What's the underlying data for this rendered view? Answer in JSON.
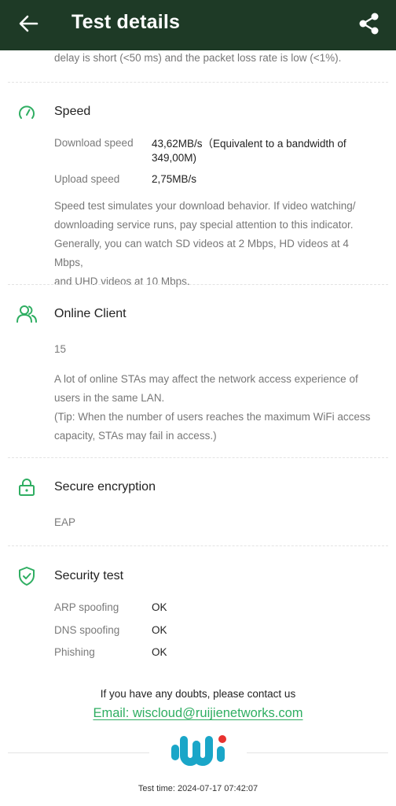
{
  "header": {
    "title": "Test details",
    "back_icon": "arrow-left-icon",
    "share_icon": "share-icon",
    "background": "#1e3a26"
  },
  "top_clip_text": "delay is short (<50 ms) and the packet loss rate is low (<1%).",
  "speed": {
    "title": "Speed",
    "icon": "speedometer-icon",
    "rows": [
      {
        "label": "Download speed",
        "value": "43,62MB/s（Equivalent to a bandwidth of",
        "value2": "349,00M)"
      },
      {
        "label": "Upload speed",
        "value": "2,75MB/s"
      }
    ],
    "description": [
      "Speed test simulates your download behavior. If video watching/",
      "downloading service runs, pay special attention to this indicator.",
      "Generally, you can watch SD videos at 2 Mbps, HD videos at 4 Mbps,",
      "and UHD videos at 10 Mbps."
    ]
  },
  "online_client": {
    "title": "Online Client",
    "icon": "users-icon",
    "count": "15",
    "description": [
      "A lot of online STAs may affect the network access experience of",
      "users in the same LAN.",
      "(Tip: When the number of users reaches the maximum WiFi access",
      "capacity, STAs may fail in access.)"
    ]
  },
  "secure_encryption": {
    "title": "Secure encryption",
    "icon": "lock-icon",
    "value": "EAP"
  },
  "security_test": {
    "title": "Security test",
    "icon": "shield-check-icon",
    "rows": [
      {
        "label": "ARP spoofing",
        "value": "OK"
      },
      {
        "label": "DNS spoofing",
        "value": "OK"
      },
      {
        "label": "Phishing",
        "value": "OK"
      }
    ]
  },
  "footer": {
    "contact_text": "If you have any doubts, please contact us",
    "email_text": "Email: wiscloud@ruijienetworks.com",
    "logo_icon": "wiscloud-logo",
    "test_time": "Test time: 2024-07-17 07:42:07"
  },
  "colors": {
    "accent": "#2fae62",
    "header": "#1e3a26",
    "logo_blue": "#1aa6c8",
    "logo_red": "#e8322f"
  }
}
